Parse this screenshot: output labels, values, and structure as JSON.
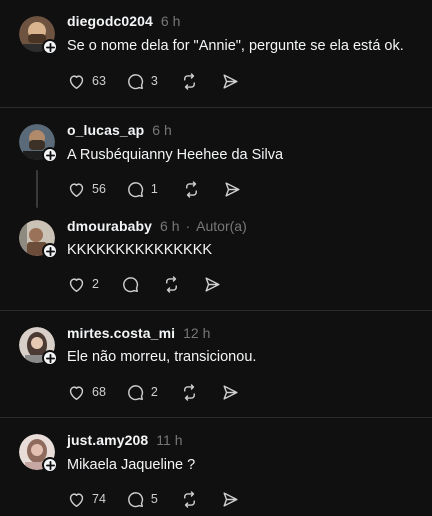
{
  "posts": [
    {
      "username": "diegodc0204",
      "time": "6 h",
      "text": "Se o nome dela for \"Annie\", pergunte se ela está ok.",
      "likes": "63",
      "replies": "3",
      "avatar_colors": [
        "#7a5a3f",
        "#d9b48f"
      ]
    },
    {
      "username": "o_lucas_ap",
      "time": "6 h",
      "text": "A Rusbéquianny Heehee da Silva",
      "likes": "56",
      "replies": "1",
      "avatar_colors": [
        "#5b6a78",
        "#3c3126"
      ]
    },
    {
      "username": "dmourababy",
      "time": "6 h",
      "author_sep": "·",
      "author_label": "Autor(a)",
      "text": "KKKKKKKKKKKKKKK",
      "likes": "2",
      "replies": "",
      "avatar_colors": [
        "#c9c2b5",
        "#6b4d3a"
      ]
    },
    {
      "username": "mirtes.costa_mi",
      "time": "12 h",
      "text": "Ele não morreu, transicionou.",
      "likes": "68",
      "replies": "2",
      "avatar_colors": [
        "#d8d0c8",
        "#4a3a33"
      ]
    },
    {
      "username": "just.amy208",
      "time": "11 h",
      "text": "Mikaela Jaqueline ?",
      "likes": "74",
      "replies": "5",
      "avatar_colors": [
        "#c7a7a2",
        "#e8ddd8"
      ]
    }
  ],
  "icons": {
    "like": "heart-icon",
    "reply": "comment-icon",
    "repost": "repost-icon",
    "share": "send-icon",
    "follow": "plus-icon"
  },
  "colors": {
    "background": "#101010",
    "text": "#f3f5f7",
    "muted": "#777777",
    "separator": "#2b2b2b"
  }
}
